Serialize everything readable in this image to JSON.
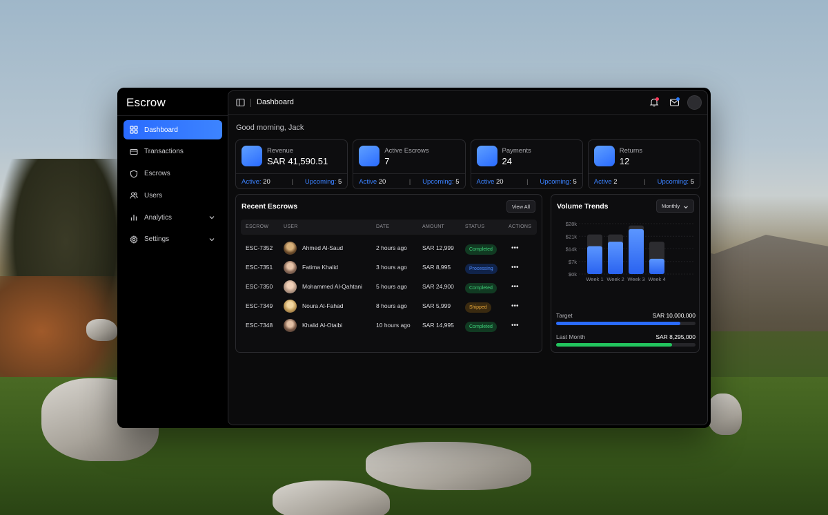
{
  "app": {
    "name": "Escrow"
  },
  "sidebar": {
    "items": [
      {
        "label": "Dashboard",
        "icon": "dashboard-icon",
        "active": true
      },
      {
        "label": "Transactions",
        "icon": "card-icon"
      },
      {
        "label": "Escrows",
        "icon": "shield-icon"
      },
      {
        "label": "Users",
        "icon": "users-icon"
      },
      {
        "label": "Analytics",
        "icon": "bar-chart-icon",
        "expandable": true
      },
      {
        "label": "Settings",
        "icon": "gear-icon",
        "expandable": true
      }
    ]
  },
  "topbar": {
    "title": "Dashboard"
  },
  "greeting": "Good morning, Jack",
  "stats": [
    {
      "label": "Revenue",
      "value": "SAR 41,590.51",
      "active_label": "Active:",
      "active": "20",
      "sep": "|",
      "upcoming_label": "Upcoming:",
      "upcoming": "5"
    },
    {
      "label": "Active Escrows",
      "value": "7",
      "active_label": "Active",
      "active": "20",
      "sep": "|",
      "upcoming_label": "Upcoming:",
      "upcoming": "5"
    },
    {
      "label": "Payments",
      "value": "24",
      "active_label": "Active",
      "active": "20",
      "sep": "|",
      "upcoming_label": "Upcoming:",
      "upcoming": "5"
    },
    {
      "label": "Returns",
      "value": "12",
      "active_label": "Active",
      "active": "2",
      "sep": "|",
      "upcoming_label": "Upcoming:",
      "upcoming": "5"
    }
  ],
  "recent": {
    "title": "Recent Escrows",
    "view_all": "View All",
    "columns": [
      "ESCROW",
      "USER",
      "DATE",
      "AMOUNT",
      "STATUS",
      "ACTIONS"
    ],
    "rows": [
      {
        "id": "ESC-7352",
        "user": "Ahmed Al-Saud",
        "date": "2 hours ago",
        "amount": "SAR 12,999",
        "status": "Completed",
        "kind": "completed"
      },
      {
        "id": "ESC-7351",
        "user": "Fatima Khalid",
        "date": "3 hours ago",
        "amount": "SAR 8,995",
        "status": "Processing",
        "kind": "processing"
      },
      {
        "id": "ESC-7350",
        "user": "Mohammed Al-Qahtani",
        "date": "5 hours ago",
        "amount": "SAR 24,900",
        "status": "Completed",
        "kind": "completed"
      },
      {
        "id": "ESC-7349",
        "user": "Noura Al-Fahad",
        "date": "8 hours ago",
        "amount": "SAR 5,999",
        "status": "Shipped",
        "kind": "shipped"
      },
      {
        "id": "ESC-7348",
        "user": "Khalid Al-Otaibi",
        "date": "10 hours ago",
        "amount": "SAR 14,995",
        "status": "Completed",
        "kind": "completed"
      }
    ],
    "actions_glyph": "•••"
  },
  "volume": {
    "title": "Volume Trends",
    "period": "Monthly",
    "target_label": "Target",
    "target_value": "SAR 10,000,000",
    "target_progress": 0.89,
    "last_label": "Last Month",
    "last_value": "SAR 8,295,000",
    "last_progress": 0.83
  },
  "chart_data": {
    "type": "bar",
    "categories": [
      "Week 1",
      "Week 2",
      "Week 3",
      "Week 4"
    ],
    "yticks": [
      "$28k",
      "$21k",
      "$14k",
      "$7k",
      "$0k"
    ],
    "ylim": [
      0,
      28
    ],
    "series": [
      {
        "values": [
          15.5,
          18,
          25,
          8.5
        ]
      }
    ],
    "backgrounds": [
      22,
      22,
      27,
      18
    ]
  },
  "colors": {
    "accent": "#2a6bff",
    "success": "#22c55e"
  }
}
